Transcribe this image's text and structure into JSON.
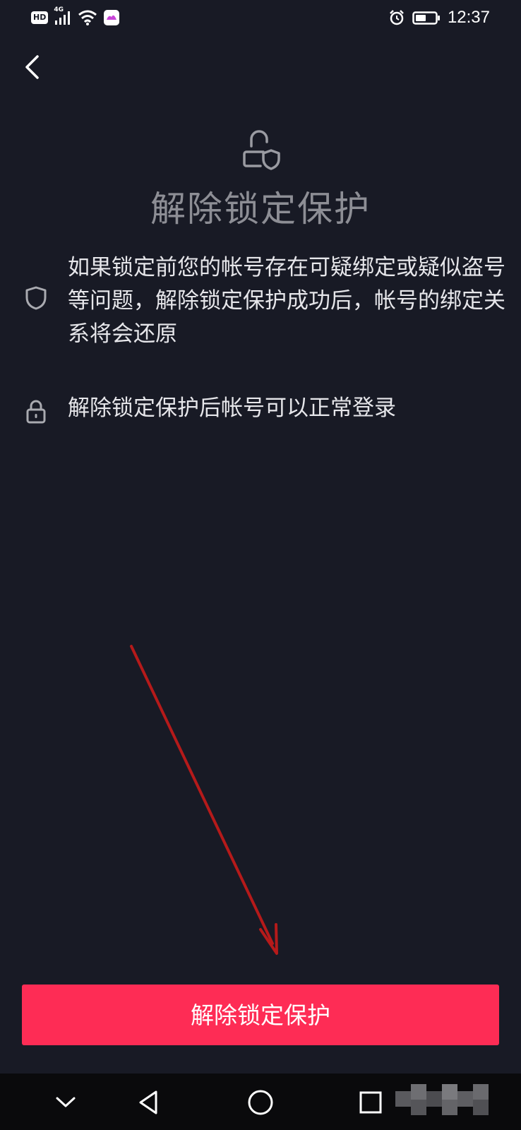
{
  "status_bar": {
    "network_badge": "HD",
    "network_type": "4G",
    "time": "12:37",
    "icons": [
      "hd-icon",
      "signal-icon",
      "wifi-icon",
      "app-notification-icon",
      "alarm-icon",
      "battery-icon"
    ]
  },
  "header": {
    "back_icon": "chevron-left-icon",
    "hero_icon": "lock-shield-icon",
    "title": "解除锁定保护"
  },
  "info_items": [
    {
      "icon": "shield-icon",
      "text": "如果锁定前您的帐号存在可疑绑定或疑似盗号等问题，解除锁定保护成功后，帐号的绑定关系将会还原"
    },
    {
      "icon": "lock-icon",
      "text": "解除锁定保护后帐号可以正常登录"
    }
  ],
  "primary_button": {
    "label": "解除锁定保护"
  },
  "colors": {
    "background": "#181a25",
    "accent": "#fe2c55",
    "annotation_arrow": "#b51a1a",
    "title_text": "#8d8e95",
    "body_text": "#e6e6ea"
  },
  "nav_bar": {
    "buttons": [
      "chevron-down-icon",
      "back-triangle-icon",
      "home-circle-icon",
      "recents-square-icon"
    ]
  }
}
